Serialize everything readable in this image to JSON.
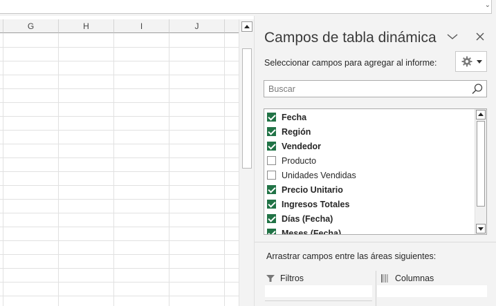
{
  "sheet": {
    "columns": [
      "G",
      "H",
      "I",
      "J"
    ]
  },
  "pane": {
    "title": "Campos de tabla dinámica",
    "subtitle": "Seleccionar campos para agregar al informe:",
    "search_placeholder": "Buscar",
    "fields": [
      {
        "label": "Fecha",
        "checked": true
      },
      {
        "label": "Región",
        "checked": true
      },
      {
        "label": "Vendedor",
        "checked": true
      },
      {
        "label": "Producto",
        "checked": false
      },
      {
        "label": "Unidades Vendidas",
        "checked": false
      },
      {
        "label": "Precio Unitario",
        "checked": true
      },
      {
        "label": "Ingresos Totales",
        "checked": true
      },
      {
        "label": "Días (Fecha)",
        "checked": true
      },
      {
        "label": "Meses (Fecha)",
        "checked": true
      }
    ],
    "areas_title": "Arrastrar campos entre las áreas siguientes:",
    "areas": {
      "filters_label": "Filtros",
      "columns_label": "Columnas"
    }
  },
  "colors": {
    "check_accent": "#217346",
    "pane_bg": "#f3f3f3"
  },
  "icons": [
    "chevron-down-icon",
    "close-icon",
    "gear-icon",
    "search-icon",
    "filter-icon",
    "columns-icon"
  ]
}
